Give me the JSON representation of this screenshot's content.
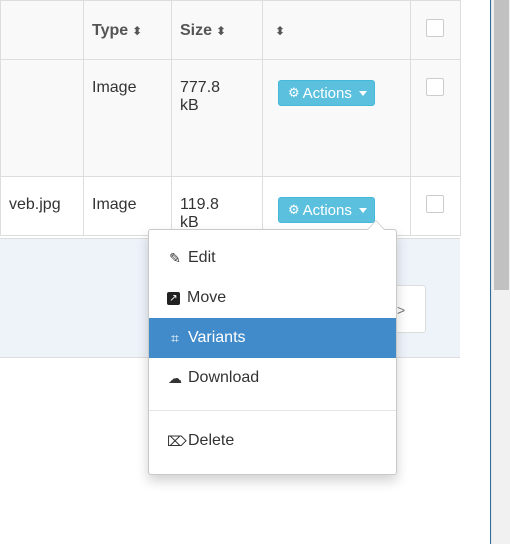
{
  "table": {
    "headers": {
      "type": "Type",
      "size": "Size",
      "sort_glyph": "⬍"
    },
    "rows": [
      {
        "name": "",
        "type": "Image",
        "size_line1": "777.8",
        "size_line2": "kB",
        "actions_label": "Actions"
      },
      {
        "name": "veb.jpg",
        "type": "Image",
        "size_line1": "119.8",
        "size_line2": "kB",
        "actions_label": "Actions"
      }
    ]
  },
  "pager": {
    "next_glyph": ">"
  },
  "dropdown": {
    "items": [
      {
        "label": "Edit",
        "icon": "pencil-square-icon",
        "glyph": "✎"
      },
      {
        "label": "Move",
        "icon": "move-arrow-icon",
        "glyph": "↗"
      },
      {
        "label": "Variants",
        "icon": "crop-icon",
        "glyph": "⌗",
        "active": true
      },
      {
        "label": "Download",
        "icon": "cloud-download-icon",
        "glyph": "☁"
      },
      {
        "label": "Delete",
        "icon": "trash-icon",
        "glyph": "⌦"
      }
    ]
  },
  "colors": {
    "accent": "#5bc0de",
    "active_item": "#428bca",
    "footer_bg": "#eef3fa"
  }
}
